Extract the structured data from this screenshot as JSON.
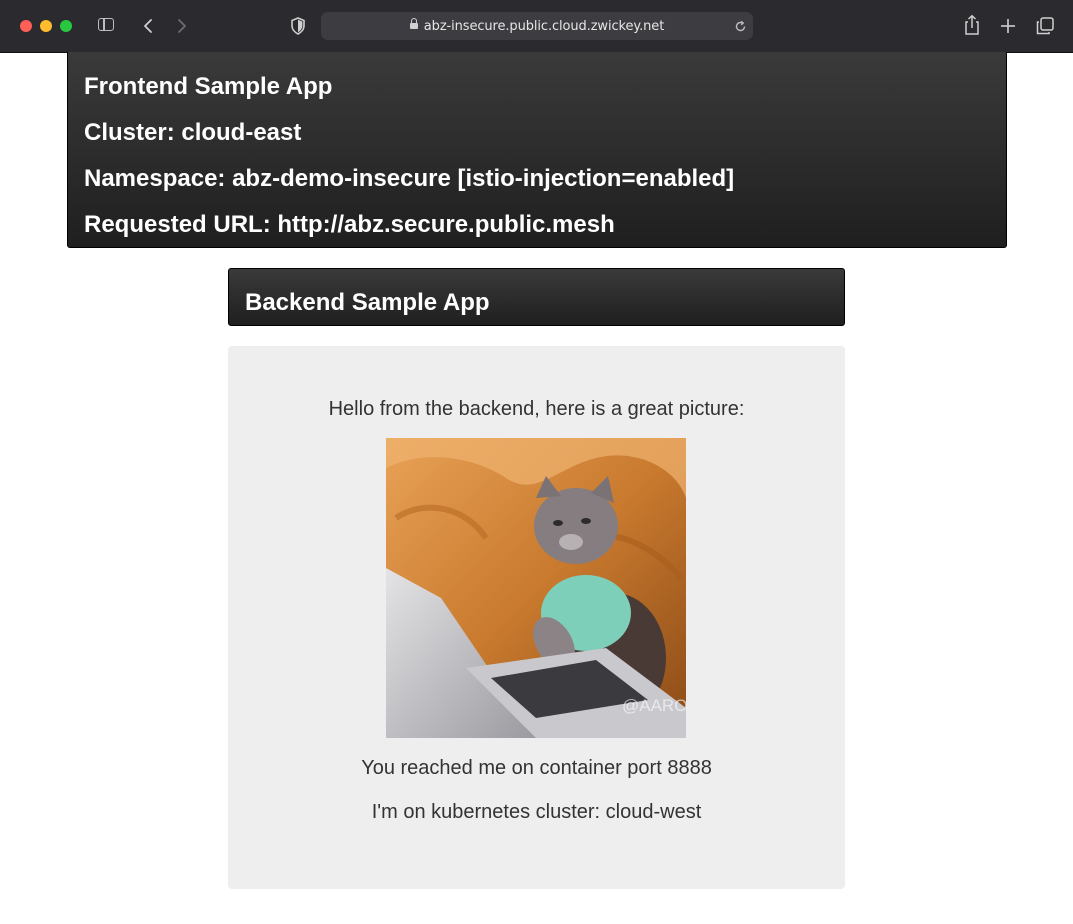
{
  "browser": {
    "url": "abz-insecure.public.cloud.zwickey.net"
  },
  "frontend": {
    "title": "Frontend Sample App",
    "cluster": "Cluster: cloud-east",
    "namespace": "Namespace: abz-demo-insecure [istio-injection=enabled]",
    "requested_url": "Requested URL: http://abz.secure.public.mesh"
  },
  "backend": {
    "title": "Backend Sample App",
    "greeting": "Hello from the backend, here is a great picture:",
    "image_watermark": "@AARON",
    "port_text": "You reached me on container port 8888",
    "cluster_text": "I'm on kubernetes cluster: cloud-west"
  },
  "icons": {
    "sidebar": "sidebar-icon",
    "back": "chevron-left-icon",
    "forward": "chevron-right-icon",
    "shield": "shield-icon",
    "lock": "lock-icon",
    "reload": "reload-icon",
    "share": "share-icon",
    "new_tab": "plus-icon",
    "tabs": "tabs-overview-icon"
  },
  "colors": {
    "toolbar": "#2b2a2e",
    "header_bg": "#2a2a2a",
    "panel_bg": "#eeeeee"
  }
}
